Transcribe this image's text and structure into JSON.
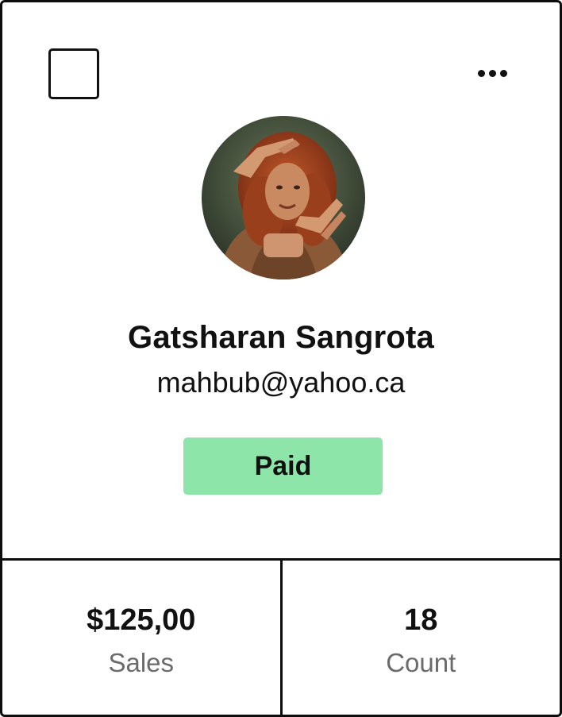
{
  "profile": {
    "name": "Gatsharan Sangrota",
    "email": "mahbub@yahoo.ca",
    "status": "Paid",
    "status_color": "#8de5aa"
  },
  "stats": [
    {
      "value": "$125,00",
      "label": "Sales"
    },
    {
      "value": "18",
      "label": "Count"
    }
  ],
  "icons": {
    "menu": "more-horizontal-icon",
    "select": "checkbox-icon"
  }
}
